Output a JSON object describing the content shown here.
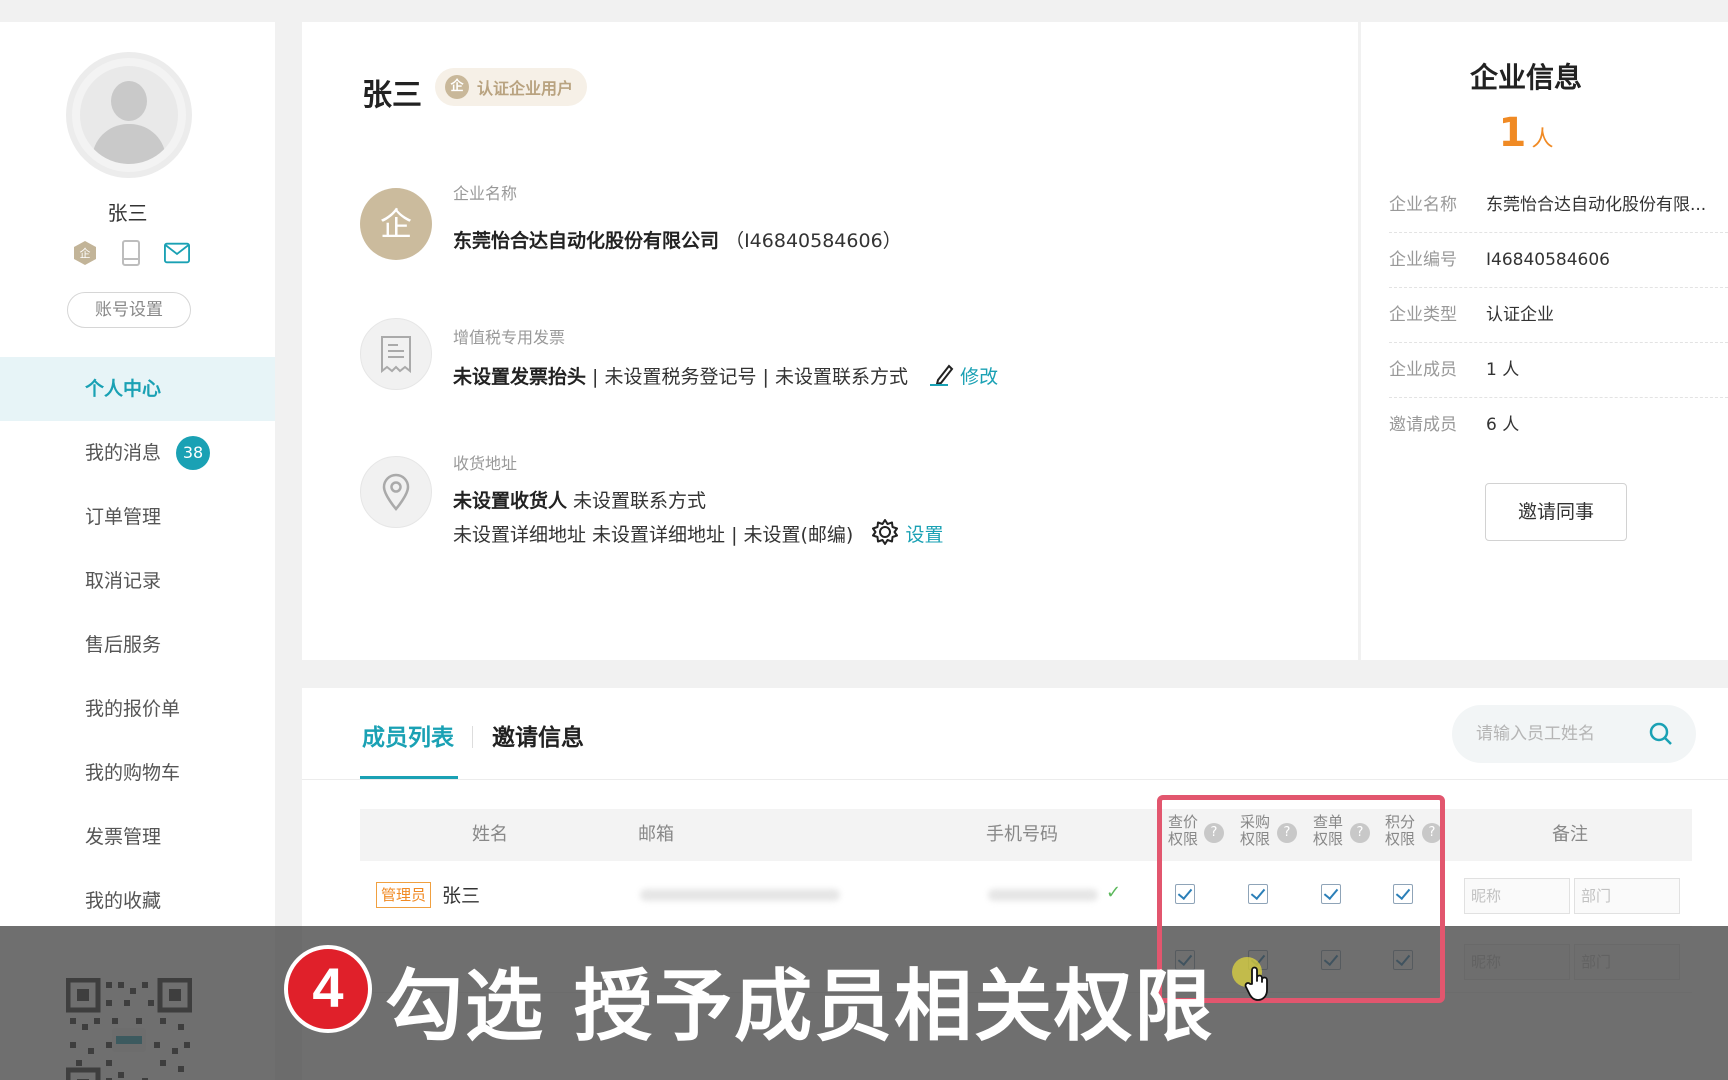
{
  "sidebar": {
    "username": "张三",
    "account_button": "账号设置",
    "nav": [
      {
        "label": "个人中心",
        "active": true
      },
      {
        "label": "我的消息",
        "badge": "38"
      },
      {
        "label": "订单管理"
      },
      {
        "label": "取消记录"
      },
      {
        "label": "售后服务"
      },
      {
        "label": "我的报价单"
      },
      {
        "label": "我的购物车"
      },
      {
        "label": "发票管理"
      },
      {
        "label": "我的收藏"
      }
    ]
  },
  "profile": {
    "name": "张三",
    "badge_icon_char": "企",
    "badge": "认证企业用户",
    "company": {
      "icon_char": "企",
      "label": "企业名称",
      "name": "东莞怡合达自动化股份有限公司",
      "paren_open": "（",
      "id": "I46840584606",
      "paren_close": "）"
    },
    "invoice": {
      "label": "增值税专用发票",
      "title": "未设置发票抬头",
      "rest": " | 未设置税务登记号 | 未设置联系方式",
      "edit": "修改"
    },
    "address": {
      "label": "收货地址",
      "receiver": "未设置收货人",
      "contact": " 未设置联系方式",
      "detail": "未设置详细地址 未设置详细地址 | 未设置(邮编)",
      "setup": "设置"
    }
  },
  "enterprise": {
    "title": "企业信息",
    "count": "1",
    "count_unit": "人",
    "rows": [
      {
        "k": "企业名称",
        "v": "东莞怡合达自动化股份有限..."
      },
      {
        "k": "企业编号",
        "v": "I46840584606"
      },
      {
        "k": "企业类型",
        "v": "认证企业"
      },
      {
        "k": "企业成员",
        "v": "1 人"
      },
      {
        "k": "邀请成员",
        "v": "6 人"
      }
    ],
    "invite_button": "邀请同事"
  },
  "members": {
    "tab_active": "成员列表",
    "tab_inactive": "邀请信息",
    "search_placeholder": "请输入员工姓名",
    "headers": {
      "name": "姓名",
      "email": "邮箱",
      "phone": "手机号码",
      "perm_price": "查价权限",
      "perm_purchase": "采购权限",
      "perm_order": "查单权限",
      "perm_points": "积分权限",
      "help": "?",
      "remark": "备注"
    },
    "rows": [
      {
        "role": "管理员",
        "name": "张三",
        "nickname_placeholder": "昵称",
        "dept_placeholder": "部门"
      },
      {
        "role": "",
        "name": "",
        "nickname_placeholder": "昵称",
        "dept_placeholder": "部门"
      }
    ],
    "phone_check": "✓"
  },
  "overlay": {
    "step": "4",
    "caption": "勾选 授予成员相关权限"
  },
  "colors": {
    "accent": "#1aa1b4",
    "orange": "#f08a24",
    "highlight": "#e2566e",
    "step_red": "#e0202a"
  }
}
